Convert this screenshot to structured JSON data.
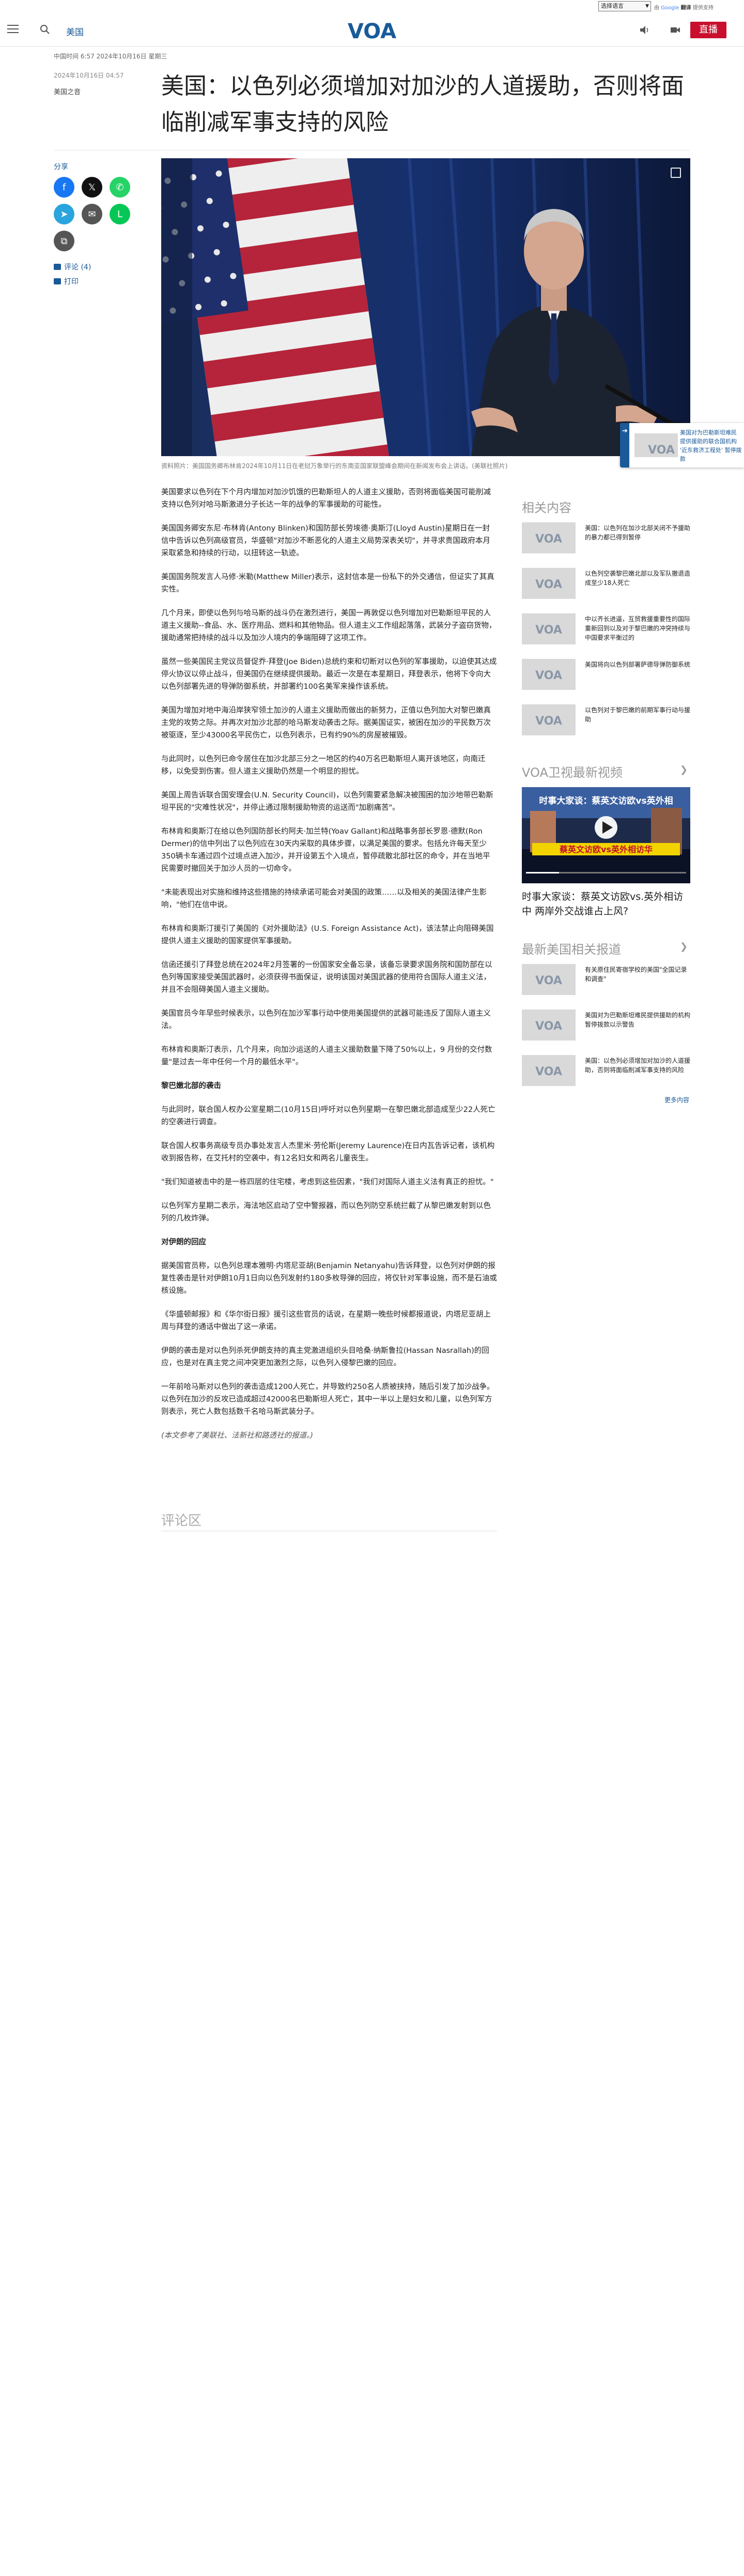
{
  "translate": {
    "select_label": "选择语言",
    "powered_prefix": "由",
    "powered_google": "Google",
    "powered_suffix": "翻译",
    "powered_brand": "提供支持"
  },
  "header": {
    "section": "美国",
    "logo_text": "VOA",
    "live_label": "直播"
  },
  "meta": {
    "updated": "中国时间 6:57 2024年10月16日 星期三",
    "date": "2024年10月16日 04:57",
    "category": "美国之音"
  },
  "title": "美国：以色列必须增加对加沙的人道援助，否则将面临削减军事支持的风险",
  "share": {
    "label": "分享",
    "facebook_icon": "f",
    "x_icon": "𝕏",
    "whatsapp_icon": "✆",
    "telegram_icon": "➤",
    "email_icon": "✉",
    "line_icon": "L",
    "copy_icon": "⧉"
  },
  "aside": {
    "comments": "评论 (4)",
    "print": "打印"
  },
  "photo": {
    "caption": "资料照片：美国国务卿布林肯2024年10月11日在老挝万象举行的东南亚国家联盟峰会期间在新闻发布会上讲话。(美联社照片)"
  },
  "float_card": {
    "text": "美国对为巴勒斯坦难民提供援助的联合国机构 '近东救济工程处' 暂停拨款"
  },
  "article": {
    "paragraphs": [
      "美国要求以色列在下个月内增加对加沙饥饿的巴勒斯坦人的人道主义援助，否则将面临美国可能削减支持以色列对哈马斯激进分子长达一年的战争的军事援助的可能性。",
      "美国国务卿安东尼·布林肯(Antony Blinken)和国防部长劳埃德·奥斯汀(Lloyd Austin)星期日在一封信中告诉以色列高级官员，华盛顿\"对加沙不断恶化的人道主义局势深表关切\"，并寻求贵国政府本月采取紧急和持续的行动，以扭转这一轨迹。",
      "美国国务院发言人马修·米勒(Matthew Miller)表示，这封信本是一份私下的外交通信，但证实了其真实性。",
      "几个月来，即使以色列与哈马斯的战斗仍在激烈进行，美国一再敦促以色列增加对巴勒斯坦平民的人道主义援助--食品、水、医疗用品、燃料和其他物品。但人道主义工作组起落落，武装分子盗窃货物，援助通常把持续的战斗以及加沙人境内的争端阻碍了这项工作。",
      "虽然一些美国民主党议员督促乔·拜登(Joe Biden)总统约束和切断对以色列的军事援助，以迫使其达成停火协议以停止战斗，但美国仍在继续提供援助。最近一次是在本星期日，拜登表示，他将下令向大以色列部署先进的导弹防御系统，并部署约100名美军来操作该系统。",
      "美国为增加对地中海沿岸狭窄领土加沙的人道主义援助而做出的新努力，正值以色列加大对黎巴嫩真主党的攻势之际。并再次对加沙北部的哈马斯发动袭击之际。据美国证实，被困在加沙的平民数万次被驱逐，至少43000名平民伤亡，以色列表示，已有约90%的房屋被摧毁。",
      "与此同时，以色列已命令居住在加沙北部三分之一地区的约40万名巴勒斯坦人离开该地区，向南迁移，以免受到伤害。但人道主义援助仍然是一个明显的担忧。",
      "美国上周告诉联合国安理会(U.N. Security Council)，以色列需要紧急解决被围困的加沙地带巴勒斯坦平民的\"灾难性状况\"，并停止通过限制援助物资的运送而\"加剧痛苦\"。",
      "布林肯和奥斯汀在给以色列国防部长约阿夫·加兰特(Yoav Gallant)和战略事务部长罗恩·德默(Ron Dermer)的信中列出了以色列应在30天内采取的具体步骤，以满足美国的要求。包括允许每天至少350辆卡车通过四个过境点进入加沙，并开设第五个入境点，暂停疏散北部社区的命令，并在当地平民需要时撤回关于加沙人员的一切命令。",
      "\"未能表现出对实施和维持这些措施的持续承诺可能会对美国的政策……以及相关的美国法律产生影响，\"他们在信中说。",
      "布林肯和奥斯汀援引了美国的《对外援助法》(U.S. Foreign Assistance Act)，该法禁止向阻碍美国提供人道主义援助的国家提供军事援助。",
      "信函还援引了拜登总统在2024年2月签署的一份国家安全备忘录，该备忘录要求国务院和国防部在以色列等国家接受美国武器时，必须获得书面保证，说明该国对美国武器的使用符合国际人道主义法，并且不会阻碍美国人道主义援助。",
      "美国官员今年早些时候表示，以色列在加沙军事行动中使用美国提供的武器可能违反了国际人道主义法。",
      "布林肯和奥斯汀表示，几个月来，向加沙运送的人道主义援助数量下降了50%以上，9 月份的交付数量\"是过去一年中任何一个月的最低水平\"。"
    ],
    "heading_1": "黎巴嫩北部的袭击",
    "paragraphs_2": [
      "与此同时，联合国人权办公室星期二(10月15日)呼吁对以色列星期一在黎巴嫩北部造成至少22人死亡的空袭进行调查。",
      "联合国人权事务高级专员办事处发言人杰里米·劳伦斯(Jeremy Laurence)在日内瓦告诉记者，该机构收到报告称，在艾托村的空袭中，有12名妇女和两名儿童丧生。",
      "\"我们知道被击中的是一栋四层的住宅楼，考虑到这些因素，\"我们对国际人道主义法有真正的担忧。\"",
      "以色列军方星期二表示，海法地区启动了空中警报器，而以色列防空系统拦截了从黎巴嫩发射到以色列的几枚炸弹。"
    ],
    "heading_2": "对伊朗的回应",
    "paragraphs_3": [
      "据美国官员称，以色列总理本雅明·内塔尼亚胡(Benjamin Netanyahu)告诉拜登，以色列对伊朗的报复性袭击是针对伊朗10月1日向以色列发射约180多枚导弹的回应，将仅针对军事设施，而不是石油或核设施。",
      "《华盛顿邮报》和《华尔街日报》援引这些官员的话说，在星期一晚些时候都报道说，内塔尼亚胡上周与拜登的通话中做出了这一承诺。",
      "伊朗的袭击是对以色列杀死伊朗支持的真主党激进组织头目哈桑·纳斯鲁拉(Hassan Nasrallah)的回应，也是对在真主党之间冲突更加激烈之际，以色列入侵黎巴嫩的回应。",
      "一年前哈马斯对以色列的袭击造成1200人死亡，并导致约250名人质被挟持，随后引发了加沙战争。以色列在加沙的反攻已造成超过42000名巴勒斯坦人死亡，其中一半以上是妇女和儿童，以色列军方则表示，死亡人数包括数千名哈马斯武装分子。"
    ],
    "note": "(本文参考了美联社、法新社和路透社的报道。)"
  },
  "comments": {
    "title": "评论区"
  },
  "sidebar": {
    "related_heading": "相关内容",
    "related": [
      "美国：以色列在加沙北部关闭不予援助的暴力都已得到暂停",
      "以色列空袭黎巴嫩北部以及军队撤退造成至少18人死亡",
      "中以齐长进逼，互贸救援重要性的国际重新回到以及对于黎巴嫩的冲突持续与中国要求平衡过的",
      "美国将向以色列部署萨德导弹防御系统",
      "以色列对于黎巴嫩的前期军事行动与援助"
    ],
    "video_heading": "VOA卫视最新视频",
    "video": {
      "overlay_title": "时事大家谈：蔡英文访欧vs英外相",
      "overlay_line": "蔡英文访欧vs英外相访华",
      "title": "时事大家谈：蔡英文访欧vs.英外相访中 两岸外交战谁占上风?"
    },
    "latest_heading": "最新美国相关报道",
    "latest": [
      "有关原住民寄宿学校的美国\"全国记录和调查\"",
      "美国对为巴勒斯坦难民提供援助的机构暂停拨款以示警告",
      "美国：以色列必须增加对加沙的人道援助，否则将面临削减军事支持的风险"
    ],
    "more": "更多内容"
  },
  "colors": {
    "brand_blue": "#1a5a99",
    "live_red": "#c8102e",
    "facebook": "#1877f2",
    "x": "#111111",
    "whatsapp": "#25d366",
    "telegram": "#2aa4dd",
    "email": "#555555",
    "line": "#06c755"
  }
}
